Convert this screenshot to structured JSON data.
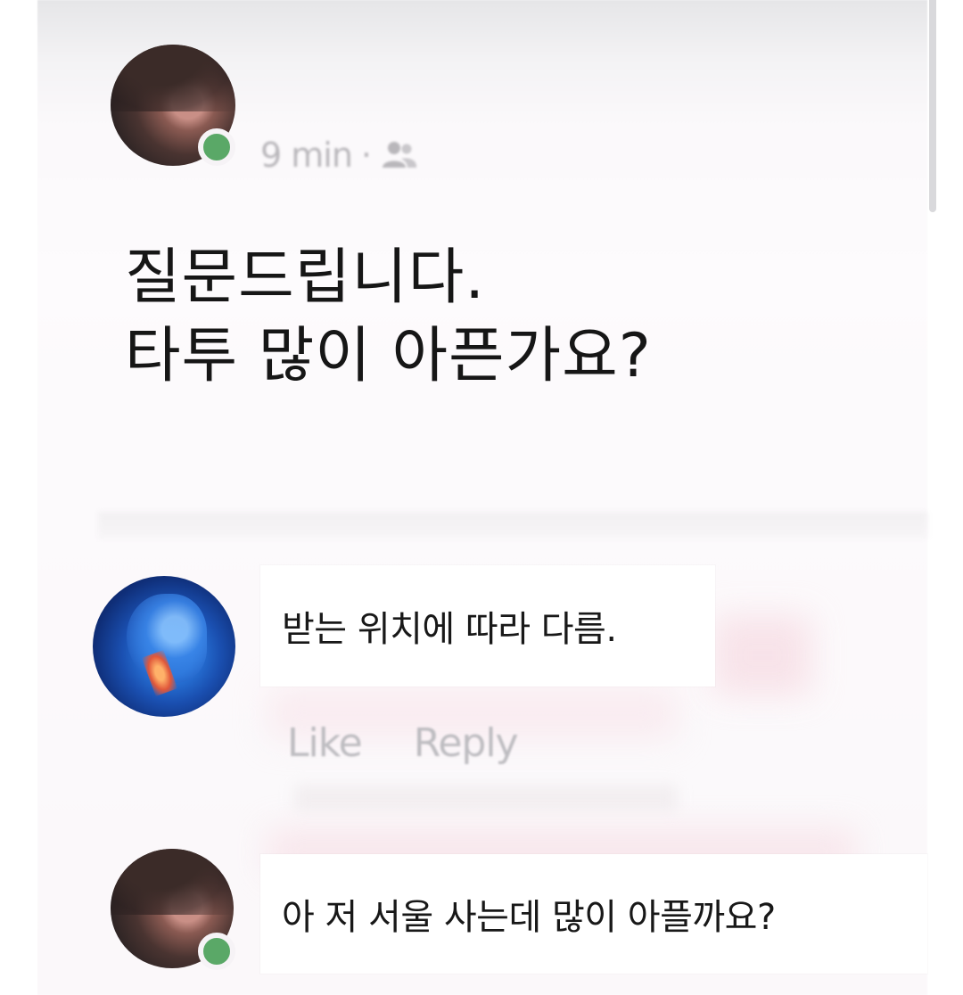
{
  "post": {
    "timestamp": "9 min",
    "separator": "·",
    "audience_icon": "friends-icon",
    "lines": [
      "질문드립니다.",
      "타투 많이 아픈가요?"
    ]
  },
  "comments": [
    {
      "avatar": "throat-illustration-avatar",
      "text": "받는 위치에 따라 다름.",
      "actions": {
        "like": "Like",
        "reply": "Reply"
      }
    },
    {
      "avatar": "user-avatar",
      "text": "아 저 서울 사는데 많이 아플까요?"
    }
  ],
  "colors": {
    "online": "#5aa867",
    "text": "#161616",
    "muted": "#bdbcc0"
  }
}
